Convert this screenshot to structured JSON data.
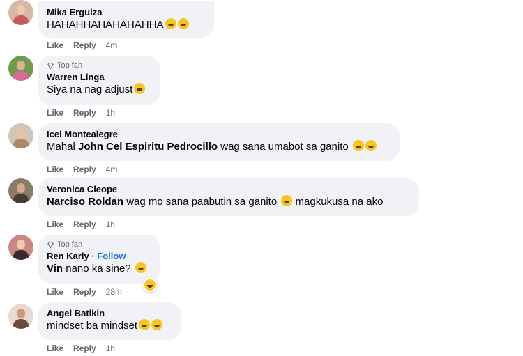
{
  "top_fan_label": "Top fan",
  "follow_label": "Follow",
  "comments": [
    {
      "name": "Mika Erguiza",
      "text": "HAHAHHAHAHAHAHHA",
      "like": "Like",
      "reply": "Reply",
      "time": "4m"
    },
    {
      "name": "Warren Linga",
      "text": "Siya na nag adjust",
      "like": "Like",
      "reply": "Reply",
      "time": "1h"
    },
    {
      "name": "Icel Montealegre",
      "text_pre": "Mahal ",
      "mention": "John Cel Espiritu Pedrocillo",
      "text_post": " wag sana umabot sa ganito ",
      "like": "Like",
      "reply": "Reply",
      "time": "4m"
    },
    {
      "name": "Veronica Cleope",
      "mention": "Narciso Roldan",
      "text_post": " wag mo sana paabutin sa ganito ",
      "text_after": " magkukusa na ako",
      "like": "Like",
      "reply": "Reply",
      "time": "1h"
    },
    {
      "name": "Ren Karly",
      "mention": "Vin",
      "text_post": " nano ka sine? ",
      "like": "Like",
      "reply": "Reply",
      "time": "28m"
    },
    {
      "name": "Angel Batikin",
      "text": "mindset ba mindset",
      "like": "Like",
      "reply": "Reply",
      "time": "1h"
    }
  ],
  "icons": {
    "top_fan": "diamond-icon",
    "emoji": "laughing-emoji-icon",
    "reaction": "haha-reaction-icon"
  },
  "colors": {
    "bubble": "#f0f2f5",
    "link": "#1b74e4",
    "meta": "#65676b",
    "emoji": "#f7c51e"
  }
}
